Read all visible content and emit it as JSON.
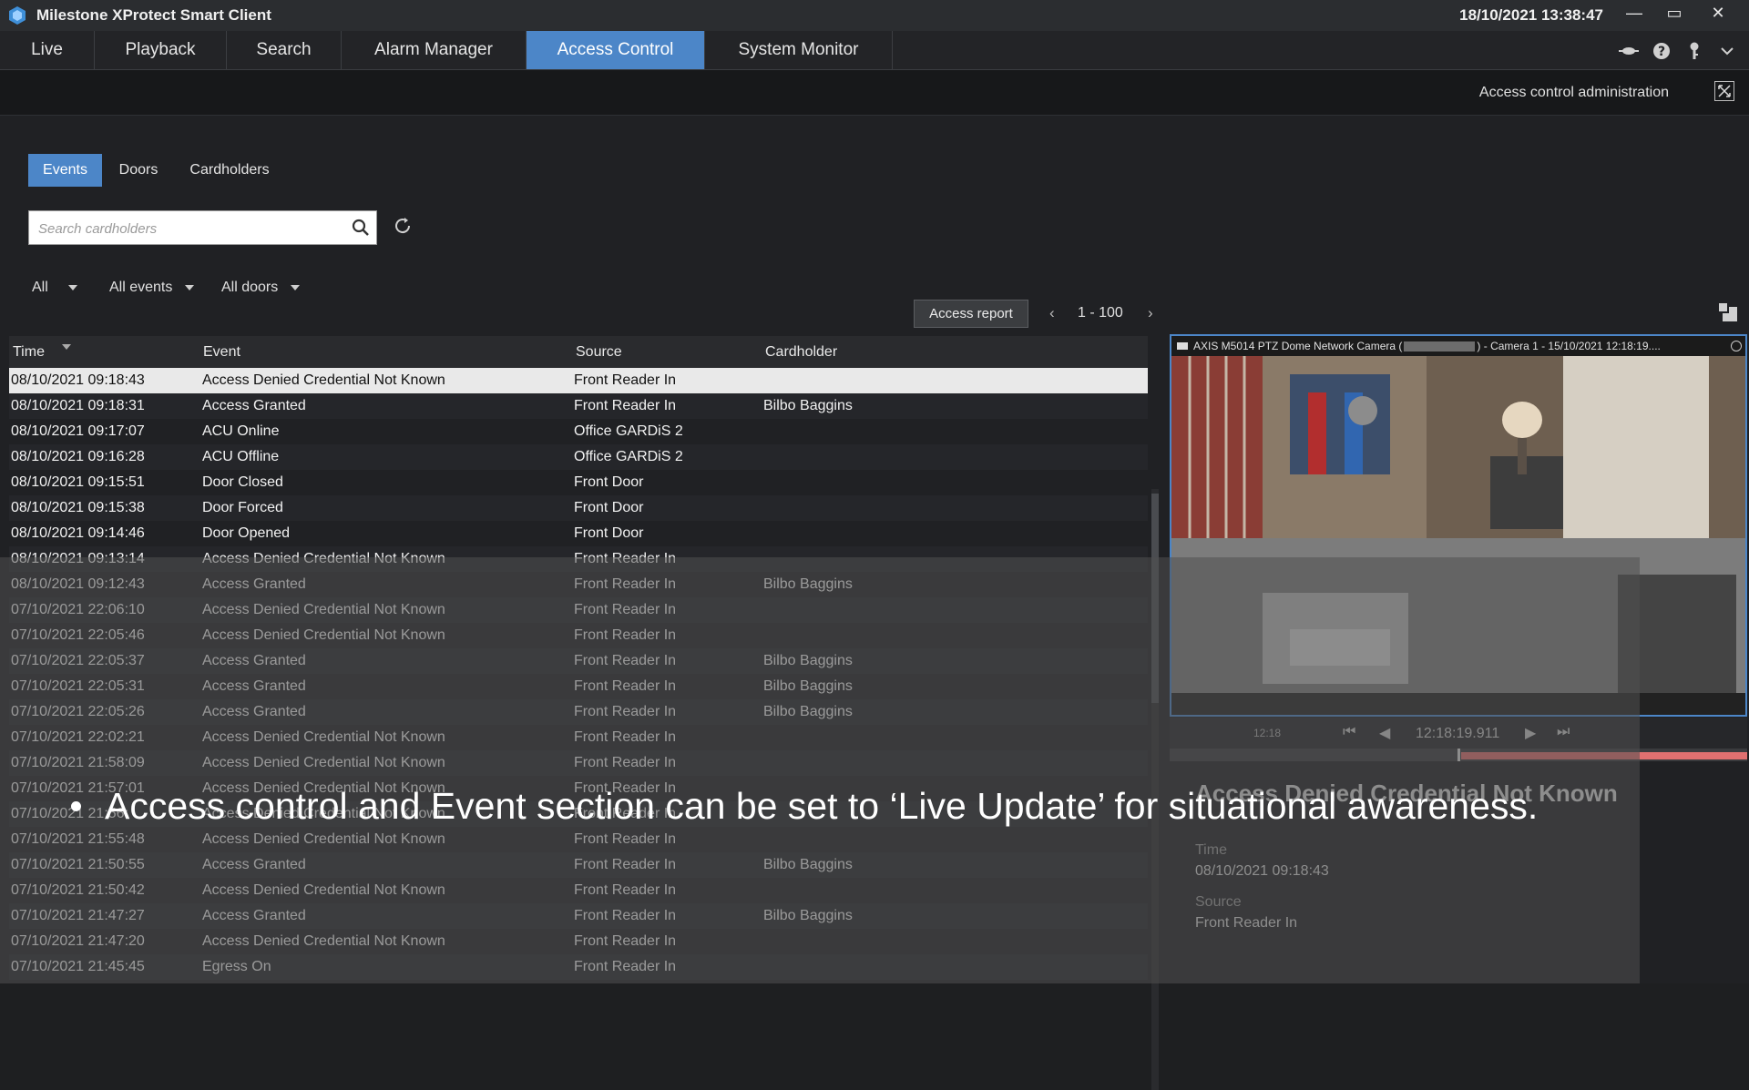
{
  "window": {
    "title": "Milestone XProtect Smart Client",
    "datetime": "18/10/2021 13:38:47",
    "minimize": "—",
    "maximize": "▭",
    "close": "✕"
  },
  "nav": {
    "tabs": [
      {
        "label": "Live"
      },
      {
        "label": "Playback"
      },
      {
        "label": "Search"
      },
      {
        "label": "Alarm Manager"
      },
      {
        "label": "Access Control"
      },
      {
        "label": "System Monitor"
      }
    ],
    "active": "Access Control"
  },
  "toolbar_icons": [
    "signal-icon",
    "help-icon",
    "key-icon",
    "chevron-down-icon"
  ],
  "subheader": {
    "title": "Access control administration"
  },
  "subtabs": [
    {
      "label": "Events"
    },
    {
      "label": "Doors"
    },
    {
      "label": "Cardholders"
    }
  ],
  "search": {
    "placeholder": "Search cardholders",
    "value": ""
  },
  "filters": {
    "scope": "All",
    "events": "All events",
    "doors": "All doors"
  },
  "report": {
    "button": "Access report",
    "range": "1 - 100",
    "prev": "‹",
    "next": "›"
  },
  "table": {
    "columns": [
      "Time",
      "Event",
      "Source",
      "Cardholder"
    ],
    "rows": [
      {
        "time": "08/10/2021 09:18:43",
        "event": "Access Denied Credential Not Known",
        "source": "Front Reader In",
        "cardholder": ""
      },
      {
        "time": "08/10/2021 09:18:31",
        "event": "Access Granted",
        "source": "Front Reader In",
        "cardholder": "Bilbo Baggins"
      },
      {
        "time": "08/10/2021 09:17:07",
        "event": "ACU Online",
        "source": "Office GARDiS 2",
        "cardholder": ""
      },
      {
        "time": "08/10/2021 09:16:28",
        "event": "ACU Offline",
        "source": "Office GARDiS 2",
        "cardholder": ""
      },
      {
        "time": "08/10/2021 09:15:51",
        "event": "Door Closed",
        "source": "Front Door",
        "cardholder": ""
      },
      {
        "time": "08/10/2021 09:15:38",
        "event": "Door Forced",
        "source": "Front Door",
        "cardholder": ""
      },
      {
        "time": "08/10/2021 09:14:46",
        "event": "Door Opened",
        "source": "Front Door",
        "cardholder": ""
      },
      {
        "time": "08/10/2021 09:13:14",
        "event": "Access Denied Credential Not Known",
        "source": "Front Reader In",
        "cardholder": ""
      },
      {
        "time": "08/10/2021 09:12:43",
        "event": "Access Granted",
        "source": "Front Reader In",
        "cardholder": "Bilbo Baggins"
      },
      {
        "time": "07/10/2021 22:06:10",
        "event": "Access Denied Credential Not Known",
        "source": "Front Reader In",
        "cardholder": ""
      },
      {
        "time": "07/10/2021 22:05:46",
        "event": "Access Denied Credential Not Known",
        "source": "Front Reader In",
        "cardholder": ""
      },
      {
        "time": "07/10/2021 22:05:37",
        "event": "Access Granted",
        "source": "Front Reader In",
        "cardholder": "Bilbo Baggins"
      },
      {
        "time": "07/10/2021 22:05:31",
        "event": "Access Granted",
        "source": "Front Reader In",
        "cardholder": "Bilbo Baggins"
      },
      {
        "time": "07/10/2021 22:05:26",
        "event": "Access Granted",
        "source": "Front Reader In",
        "cardholder": "Bilbo Baggins"
      },
      {
        "time": "07/10/2021 22:02:21",
        "event": "Access Denied Credential Not Known",
        "source": "Front Reader In",
        "cardholder": ""
      },
      {
        "time": "07/10/2021 21:58:09",
        "event": "Access Denied Credential Not Known",
        "source": "Front Reader In",
        "cardholder": ""
      },
      {
        "time": "07/10/2021 21:57:01",
        "event": "Access Denied Credential Not Known",
        "source": "Front Reader In",
        "cardholder": ""
      },
      {
        "time": "07/10/2021 21:56:",
        "event": "Access Denied Credential Not Known",
        "source": "Front Reader In",
        "cardholder": ""
      },
      {
        "time": "07/10/2021 21:55:48",
        "event": "Access Denied Credential Not Known",
        "source": "Front Reader In",
        "cardholder": ""
      },
      {
        "time": "07/10/2021 21:50:55",
        "event": "Access Granted",
        "source": "Front Reader In",
        "cardholder": "Bilbo Baggins"
      },
      {
        "time": "07/10/2021 21:50:42",
        "event": "Access Denied Credential Not Known",
        "source": "Front Reader In",
        "cardholder": ""
      },
      {
        "time": "07/10/2021 21:47:27",
        "event": "Access Granted",
        "source": "Front Reader In",
        "cardholder": "Bilbo Baggins"
      },
      {
        "time": "07/10/2021 21:47:20",
        "event": "Access Denied Credential Not Known",
        "source": "Front Reader In",
        "cardholder": ""
      },
      {
        "time": "07/10/2021 21:45:45",
        "event": "Egress On",
        "source": "Front Reader In",
        "cardholder": ""
      }
    ]
  },
  "camera": {
    "title": "AXIS M5014 PTZ Dome Network Camera (",
    "title_suffix": ") - Camera 1 - 15/10/2021 12:18:19....",
    "playback_time": "12:18:19.911",
    "time_label": "12:18"
  },
  "details": {
    "title": "Access Denied Credential Not Known",
    "time_label": "Time",
    "time_value": "08/10/2021 09:18:43",
    "source_label": "Source",
    "source_value": "Front Reader In"
  },
  "caption": "Access control and Event section can be set to ‘Live Update’ for situational awareness.",
  "colors": {
    "accent": "#4c86c8",
    "background": "#202124",
    "timeline_red": "#e07070"
  }
}
